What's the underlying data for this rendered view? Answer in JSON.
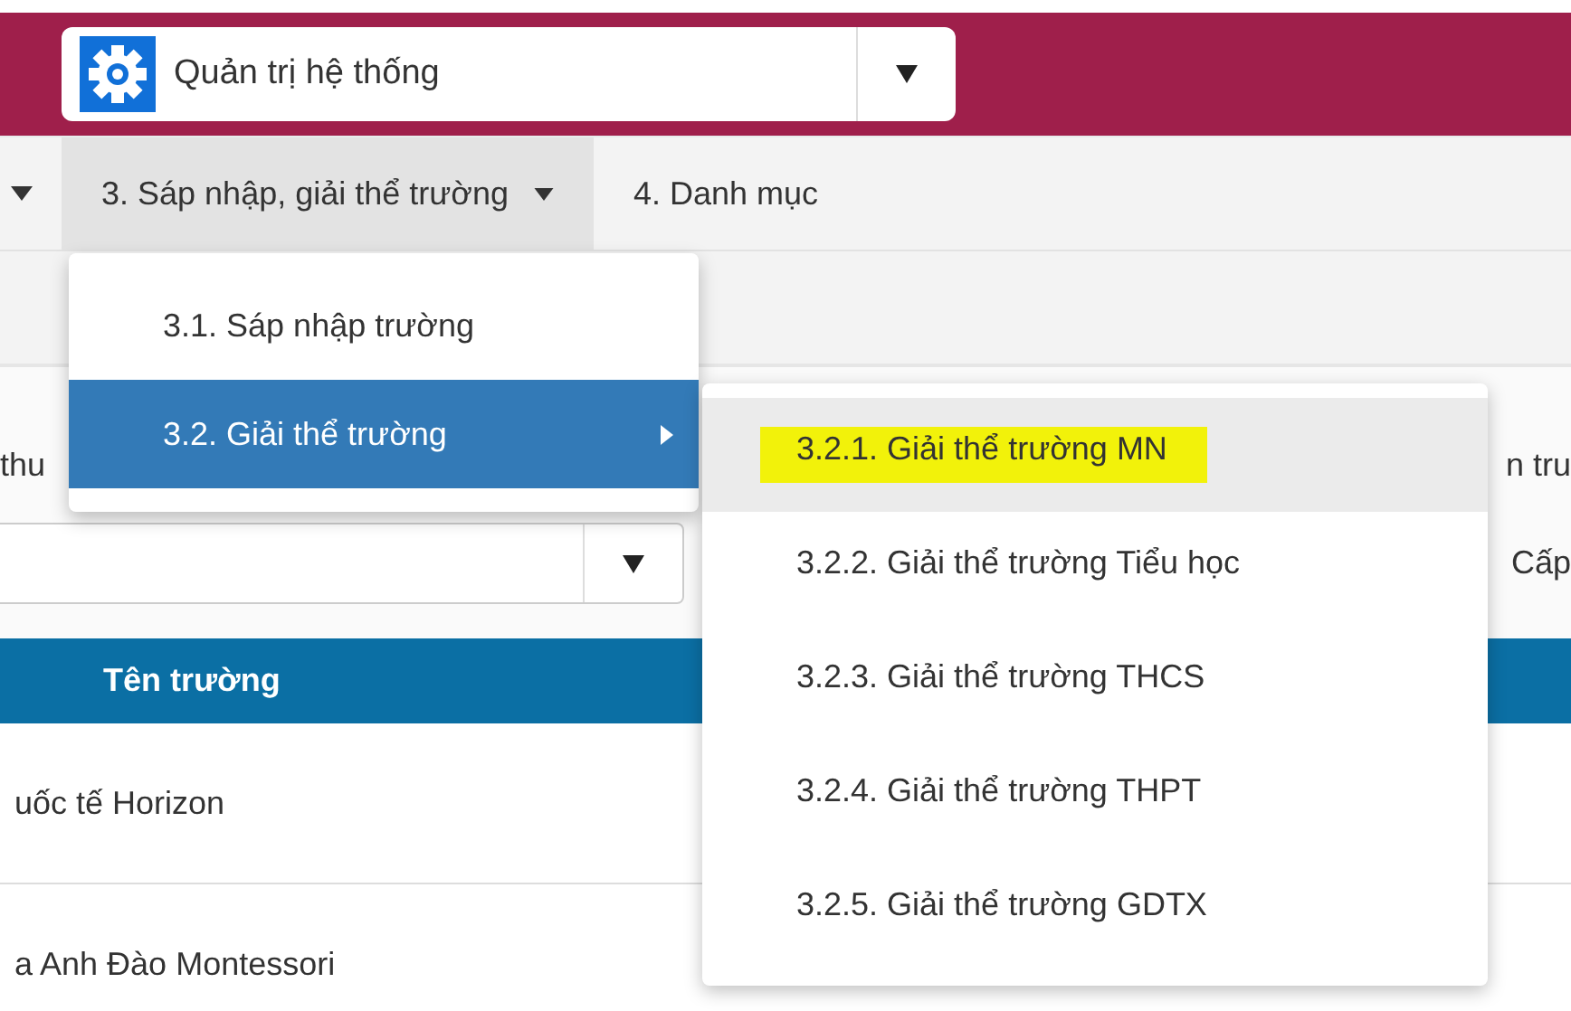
{
  "header": {
    "module_select": {
      "value": "Quản trị hệ thống"
    }
  },
  "nav": [
    {
      "label": "3. Sáp nhập, giải thể trường",
      "has_caret": true,
      "selected": true
    },
    {
      "label": "4. Danh mục",
      "has_caret": false,
      "selected": false
    }
  ],
  "menu": {
    "items": [
      {
        "label": "3.1. Sáp nhập trường",
        "selected": false,
        "has_submenu": false
      },
      {
        "label": "3.2. Giải thể trường",
        "selected": true,
        "has_submenu": true
      }
    ]
  },
  "submenu": {
    "items": [
      {
        "label": "3.2.1. Giải thể trường MN",
        "selected": true,
        "highlighted": true
      },
      {
        "label": "3.2.2. Giải thể trường Tiểu học",
        "selected": false,
        "highlighted": false
      },
      {
        "label": "3.2.3. Giải thể trường THCS",
        "selected": false,
        "highlighted": false
      },
      {
        "label": "3.2.4. Giải thể trường THPT",
        "selected": false,
        "highlighted": false
      },
      {
        "label": "3.2.5. Giải thể trường GDTX",
        "selected": false,
        "highlighted": false
      }
    ]
  },
  "filters": {
    "label_left": "thu",
    "label_right": "n tru",
    "label_right_2": "Cấp"
  },
  "table": {
    "columns": [
      "Tên trường"
    ],
    "rows": [
      [
        "uốc tế Horizon"
      ],
      [
        "a Anh Đào Montessori"
      ]
    ]
  }
}
